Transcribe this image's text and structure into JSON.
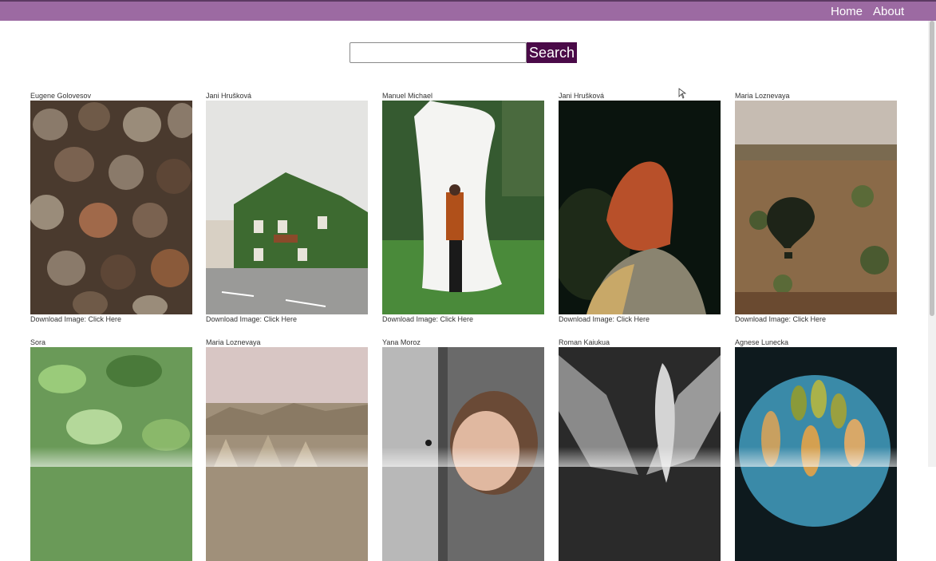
{
  "nav": {
    "home": "Home",
    "about": "About"
  },
  "search": {
    "placeholder": "",
    "button_label": "Search"
  },
  "download": {
    "prefix": "Download Image: ",
    "link_label": "Click Here"
  },
  "photos": [
    {
      "author": "Eugene Golovesov",
      "subject": "pinecones"
    },
    {
      "author": "Jani Hrušková",
      "subject": "ivy-covered-house"
    },
    {
      "author": "Manuel Michael",
      "subject": "person-with-white-fabric"
    },
    {
      "author": "Jani Hrušková",
      "subject": "woman-red-hair"
    },
    {
      "author": "Maria Loznevaya",
      "subject": "balloon-shadow-landscape"
    },
    {
      "author": "Sora",
      "subject": "green-leaves"
    },
    {
      "author": "Maria Loznevaya",
      "subject": "rock-valley"
    },
    {
      "author": "Yana Moroz",
      "subject": "woman-by-window"
    },
    {
      "author": "Roman Kaiukua",
      "subject": "black-white-leaves"
    },
    {
      "author": "Agnese Lunecka",
      "subject": "leaves-on-plate"
    }
  ],
  "colors": {
    "navbar": "#9c6aa2",
    "search_button": "#4a0a48"
  }
}
